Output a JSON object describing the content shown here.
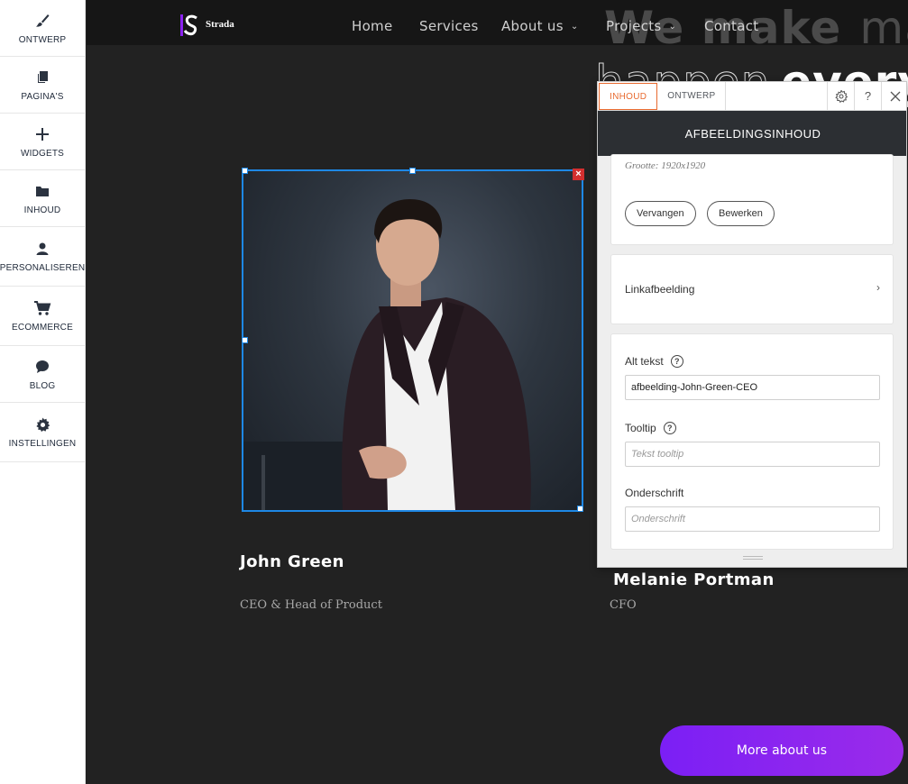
{
  "sidebar": {
    "items": [
      {
        "label": "ONTWERP",
        "icon": "paintbrush-icon"
      },
      {
        "label": "PAGINA'S",
        "icon": "pages-icon"
      },
      {
        "label": "WIDGETS",
        "icon": "plus-icon"
      },
      {
        "label": "INHOUD",
        "icon": "folder-icon"
      },
      {
        "label": "PERSONALISEREN",
        "icon": "user-icon"
      },
      {
        "label": "ECOMMERCE",
        "icon": "cart-icon"
      },
      {
        "label": "BLOG",
        "icon": "chat-bubble-icon"
      },
      {
        "label": "INSTELLINGEN",
        "icon": "gear-icon"
      }
    ]
  },
  "site": {
    "logo_text": "Strada",
    "nav": {
      "home": "Home",
      "services": "Services",
      "about": "About us",
      "projects": "Projects",
      "contact": "Contact"
    },
    "hero": {
      "line1_bold": "We make",
      "line1_light": "mag",
      "line2_light": "happen",
      "line2_bold": "every d"
    },
    "team": [
      {
        "name": "John Green",
        "role": "CEO & Head of Product"
      },
      {
        "name": "Melanie Portman",
        "role": "CFO"
      }
    ],
    "more_button": "More about us",
    "accent_color": "#8b22f0",
    "selection_color": "#1e88e5"
  },
  "panel": {
    "tabs": {
      "content": "INHOUD",
      "design": "ONTWERP"
    },
    "title": "AFBEELDINGSINHOUD",
    "size_text": "Grootte: 1920x1920",
    "replace_button": "Vervangen",
    "edit_button": "Bewerken",
    "link_image": "Linkafbeelding",
    "alt_label": "Alt tekst",
    "alt_value": "afbeelding-John-Green-CEO",
    "tooltip_label": "Tooltip",
    "tooltip_placeholder": "Tekst tooltip",
    "caption_label": "Onderschrift",
    "caption_placeholder": "Onderschrift",
    "active_tab_color": "#e86a2f"
  }
}
